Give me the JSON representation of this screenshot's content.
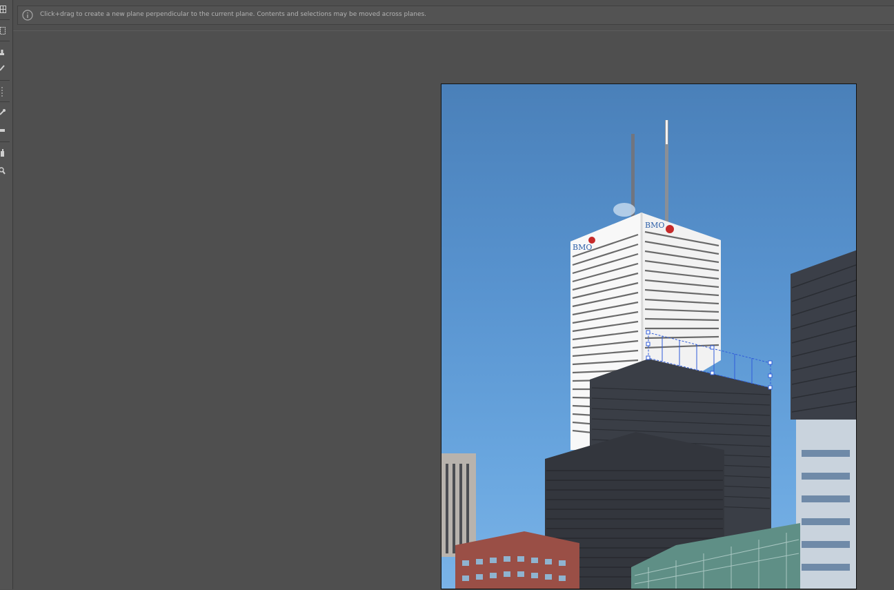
{
  "info_bar": {
    "message": "Click+drag to create a new plane perpendicular to the current plane. Contents and selections may be moved across planes.",
    "icon": "info-icon"
  },
  "toolbar": {
    "tools": [
      {
        "name": "edit-plane-tool",
        "icon": "grid-icon"
      },
      {
        "name": "marquee-tool",
        "icon": "marquee-icon"
      },
      {
        "name": "stamp-tool",
        "icon": "stamp-icon"
      },
      {
        "name": "brush-tool",
        "icon": "brush-icon"
      },
      {
        "name": "transform-tool",
        "icon": "transform-icon"
      },
      {
        "name": "eyedropper-tool",
        "icon": "eyedropper-icon"
      },
      {
        "name": "measure-tool",
        "icon": "measure-icon"
      },
      {
        "name": "hand-tool",
        "icon": "hand-icon"
      },
      {
        "name": "zoom-tool",
        "icon": "zoom-icon"
      }
    ]
  },
  "image": {
    "description_visible_text": "BMO"
  },
  "colors": {
    "ui_background": "#4f4f4f",
    "panel": "#535353",
    "grid_line": "#2f5bd9",
    "sky": "#5893cf"
  }
}
